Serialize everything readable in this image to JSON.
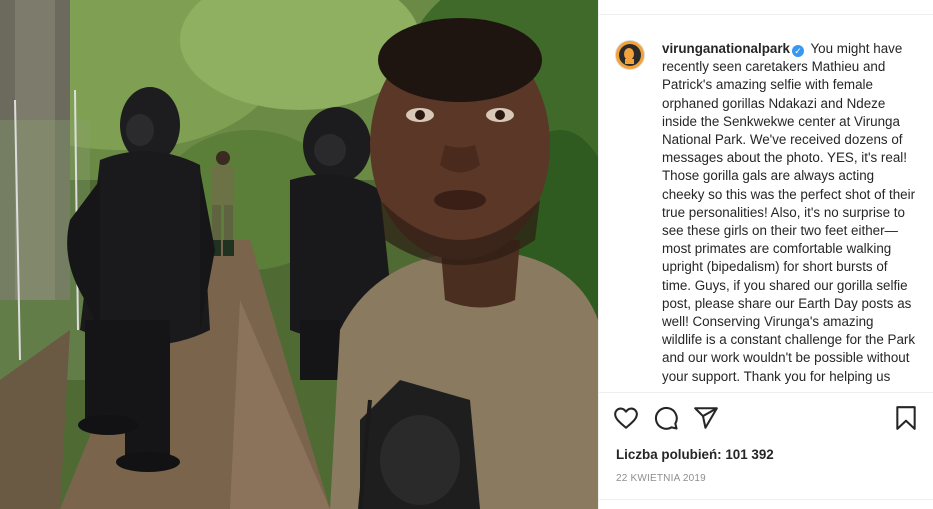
{
  "post": {
    "image_alt": "Caretaker selfie with two standing gorillas",
    "username": "virunganationalpark",
    "verified_mark": "✓",
    "caption": "You might have recently seen caretakers Mathieu and Patrick's amazing selfie with female orphaned gorillas Ndakazi and Ndeze inside the Senkwekwe center at Virunga National Park. We've received dozens of messages about the photo. YES, it's real! Those gorilla gals are always acting cheeky so this was the perfect shot of their true personalities! Also, it's no surprise to see these girls on their two feet either—most primates are comfortable walking upright (bipedalism) for short bursts of time. Guys, if you shared our gorilla selfie post, please share our Earth Day posts as well! Conserving Virunga's amazing wildlife is a constant challenge for the Park and our work wouldn't be possible without your support. Thank you for helping us",
    "likes_label": "Liczba polubień: 101 392",
    "date": "22 KWIETNIA 2019"
  },
  "icons": {
    "like": "heart-icon",
    "comment": "comment-icon",
    "share": "share-icon",
    "save": "bookmark-icon"
  },
  "colors": {
    "verified": "#3897f0",
    "text": "#262626",
    "muted": "#8e8e8e",
    "avatar_bg": "#f2a23a"
  }
}
